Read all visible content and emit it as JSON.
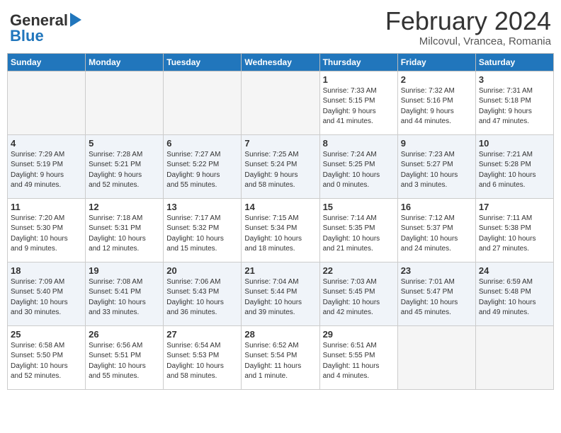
{
  "logo": {
    "text_general": "General",
    "text_blue": "Blue",
    "icon": "▶"
  },
  "title": "February 2024",
  "subtitle": "Milcovul, Vrancea, Romania",
  "weekdays": [
    "Sunday",
    "Monday",
    "Tuesday",
    "Wednesday",
    "Thursday",
    "Friday",
    "Saturday"
  ],
  "weeks": [
    [
      {
        "day": "",
        "info": ""
      },
      {
        "day": "",
        "info": ""
      },
      {
        "day": "",
        "info": ""
      },
      {
        "day": "",
        "info": ""
      },
      {
        "day": "1",
        "info": "Sunrise: 7:33 AM\nSunset: 5:15 PM\nDaylight: 9 hours\nand 41 minutes."
      },
      {
        "day": "2",
        "info": "Sunrise: 7:32 AM\nSunset: 5:16 PM\nDaylight: 9 hours\nand 44 minutes."
      },
      {
        "day": "3",
        "info": "Sunrise: 7:31 AM\nSunset: 5:18 PM\nDaylight: 9 hours\nand 47 minutes."
      }
    ],
    [
      {
        "day": "4",
        "info": "Sunrise: 7:29 AM\nSunset: 5:19 PM\nDaylight: 9 hours\nand 49 minutes."
      },
      {
        "day": "5",
        "info": "Sunrise: 7:28 AM\nSunset: 5:21 PM\nDaylight: 9 hours\nand 52 minutes."
      },
      {
        "day": "6",
        "info": "Sunrise: 7:27 AM\nSunset: 5:22 PM\nDaylight: 9 hours\nand 55 minutes."
      },
      {
        "day": "7",
        "info": "Sunrise: 7:25 AM\nSunset: 5:24 PM\nDaylight: 9 hours\nand 58 minutes."
      },
      {
        "day": "8",
        "info": "Sunrise: 7:24 AM\nSunset: 5:25 PM\nDaylight: 10 hours\nand 0 minutes."
      },
      {
        "day": "9",
        "info": "Sunrise: 7:23 AM\nSunset: 5:27 PM\nDaylight: 10 hours\nand 3 minutes."
      },
      {
        "day": "10",
        "info": "Sunrise: 7:21 AM\nSunset: 5:28 PM\nDaylight: 10 hours\nand 6 minutes."
      }
    ],
    [
      {
        "day": "11",
        "info": "Sunrise: 7:20 AM\nSunset: 5:30 PM\nDaylight: 10 hours\nand 9 minutes."
      },
      {
        "day": "12",
        "info": "Sunrise: 7:18 AM\nSunset: 5:31 PM\nDaylight: 10 hours\nand 12 minutes."
      },
      {
        "day": "13",
        "info": "Sunrise: 7:17 AM\nSunset: 5:32 PM\nDaylight: 10 hours\nand 15 minutes."
      },
      {
        "day": "14",
        "info": "Sunrise: 7:15 AM\nSunset: 5:34 PM\nDaylight: 10 hours\nand 18 minutes."
      },
      {
        "day": "15",
        "info": "Sunrise: 7:14 AM\nSunset: 5:35 PM\nDaylight: 10 hours\nand 21 minutes."
      },
      {
        "day": "16",
        "info": "Sunrise: 7:12 AM\nSunset: 5:37 PM\nDaylight: 10 hours\nand 24 minutes."
      },
      {
        "day": "17",
        "info": "Sunrise: 7:11 AM\nSunset: 5:38 PM\nDaylight: 10 hours\nand 27 minutes."
      }
    ],
    [
      {
        "day": "18",
        "info": "Sunrise: 7:09 AM\nSunset: 5:40 PM\nDaylight: 10 hours\nand 30 minutes."
      },
      {
        "day": "19",
        "info": "Sunrise: 7:08 AM\nSunset: 5:41 PM\nDaylight: 10 hours\nand 33 minutes."
      },
      {
        "day": "20",
        "info": "Sunrise: 7:06 AM\nSunset: 5:43 PM\nDaylight: 10 hours\nand 36 minutes."
      },
      {
        "day": "21",
        "info": "Sunrise: 7:04 AM\nSunset: 5:44 PM\nDaylight: 10 hours\nand 39 minutes."
      },
      {
        "day": "22",
        "info": "Sunrise: 7:03 AM\nSunset: 5:45 PM\nDaylight: 10 hours\nand 42 minutes."
      },
      {
        "day": "23",
        "info": "Sunrise: 7:01 AM\nSunset: 5:47 PM\nDaylight: 10 hours\nand 45 minutes."
      },
      {
        "day": "24",
        "info": "Sunrise: 6:59 AM\nSunset: 5:48 PM\nDaylight: 10 hours\nand 49 minutes."
      }
    ],
    [
      {
        "day": "25",
        "info": "Sunrise: 6:58 AM\nSunset: 5:50 PM\nDaylight: 10 hours\nand 52 minutes."
      },
      {
        "day": "26",
        "info": "Sunrise: 6:56 AM\nSunset: 5:51 PM\nDaylight: 10 hours\nand 55 minutes."
      },
      {
        "day": "27",
        "info": "Sunrise: 6:54 AM\nSunset: 5:53 PM\nDaylight: 10 hours\nand 58 minutes."
      },
      {
        "day": "28",
        "info": "Sunrise: 6:52 AM\nSunset: 5:54 PM\nDaylight: 11 hours\nand 1 minute."
      },
      {
        "day": "29",
        "info": "Sunrise: 6:51 AM\nSunset: 5:55 PM\nDaylight: 11 hours\nand 4 minutes."
      },
      {
        "day": "",
        "info": ""
      },
      {
        "day": "",
        "info": ""
      }
    ]
  ]
}
